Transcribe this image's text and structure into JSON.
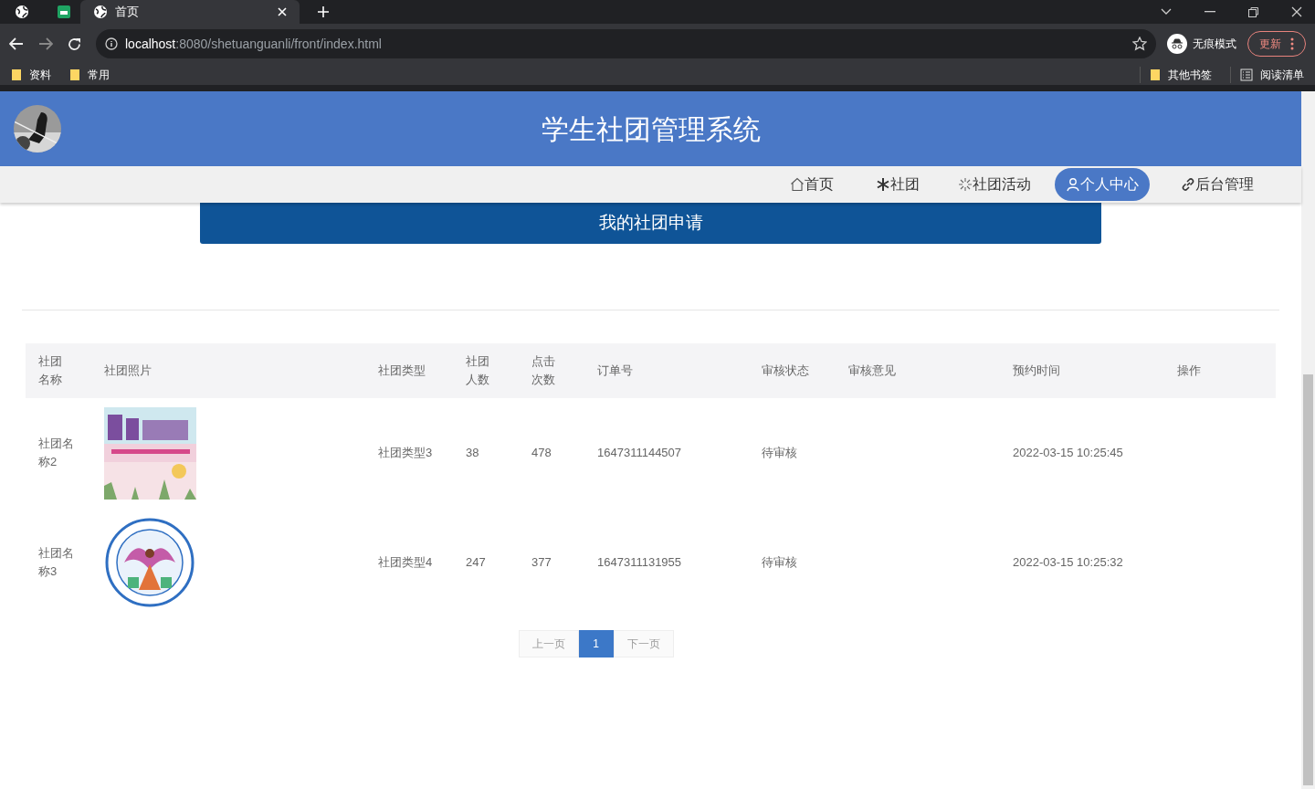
{
  "browser": {
    "tabs": [
      {
        "title": "首页",
        "selected": true
      }
    ],
    "url_host": "localhost",
    "url_path": ":8080/shetuanguanli/front/index.html",
    "profile": "无痕模式",
    "update_button": "更新",
    "bookmarks": [
      "资料",
      "常用"
    ],
    "other_bookmarks": "其他书签",
    "reading_list": "阅读清单"
  },
  "site": {
    "title": "学生社团管理系统",
    "nav": [
      {
        "kind": "home",
        "label": "首页",
        "selected": false
      },
      {
        "kind": "snowflake",
        "label": "社团",
        "selected": false
      },
      {
        "kind": "sparkle",
        "label": "社团活动",
        "selected": false
      },
      {
        "kind": "person",
        "label": "个人中心",
        "selected": true
      },
      {
        "kind": "link",
        "label": "后台管理",
        "selected": false
      }
    ],
    "banner": "我的社团申请",
    "table": {
      "columns": [
        "社团名称",
        "社团照片",
        "社团类型",
        "社团人数",
        "点击次数",
        "订单号",
        "审核状态",
        "审核意见",
        "预约时间",
        "操作"
      ],
      "rows": [
        {
          "name": "社团名称2",
          "type": "社团类型3",
          "members": "38",
          "clicks": "478",
          "order_no": "1647311144507",
          "status": "待审核",
          "time": "2022-03-15 10:25:45"
        },
        {
          "name": "社团名称3",
          "type": "社团类型4",
          "members": "247",
          "clicks": "377",
          "order_no": "1647311131955",
          "status": "待审核",
          "time": "2022-03-15 10:25:32"
        }
      ]
    },
    "pagination": {
      "prev": {
        "label": "上一页",
        "disabled": true
      },
      "pages": [
        {
          "label": "1",
          "selected": true
        }
      ],
      "next": {
        "label": "下一页",
        "disabled": true
      }
    }
  }
}
